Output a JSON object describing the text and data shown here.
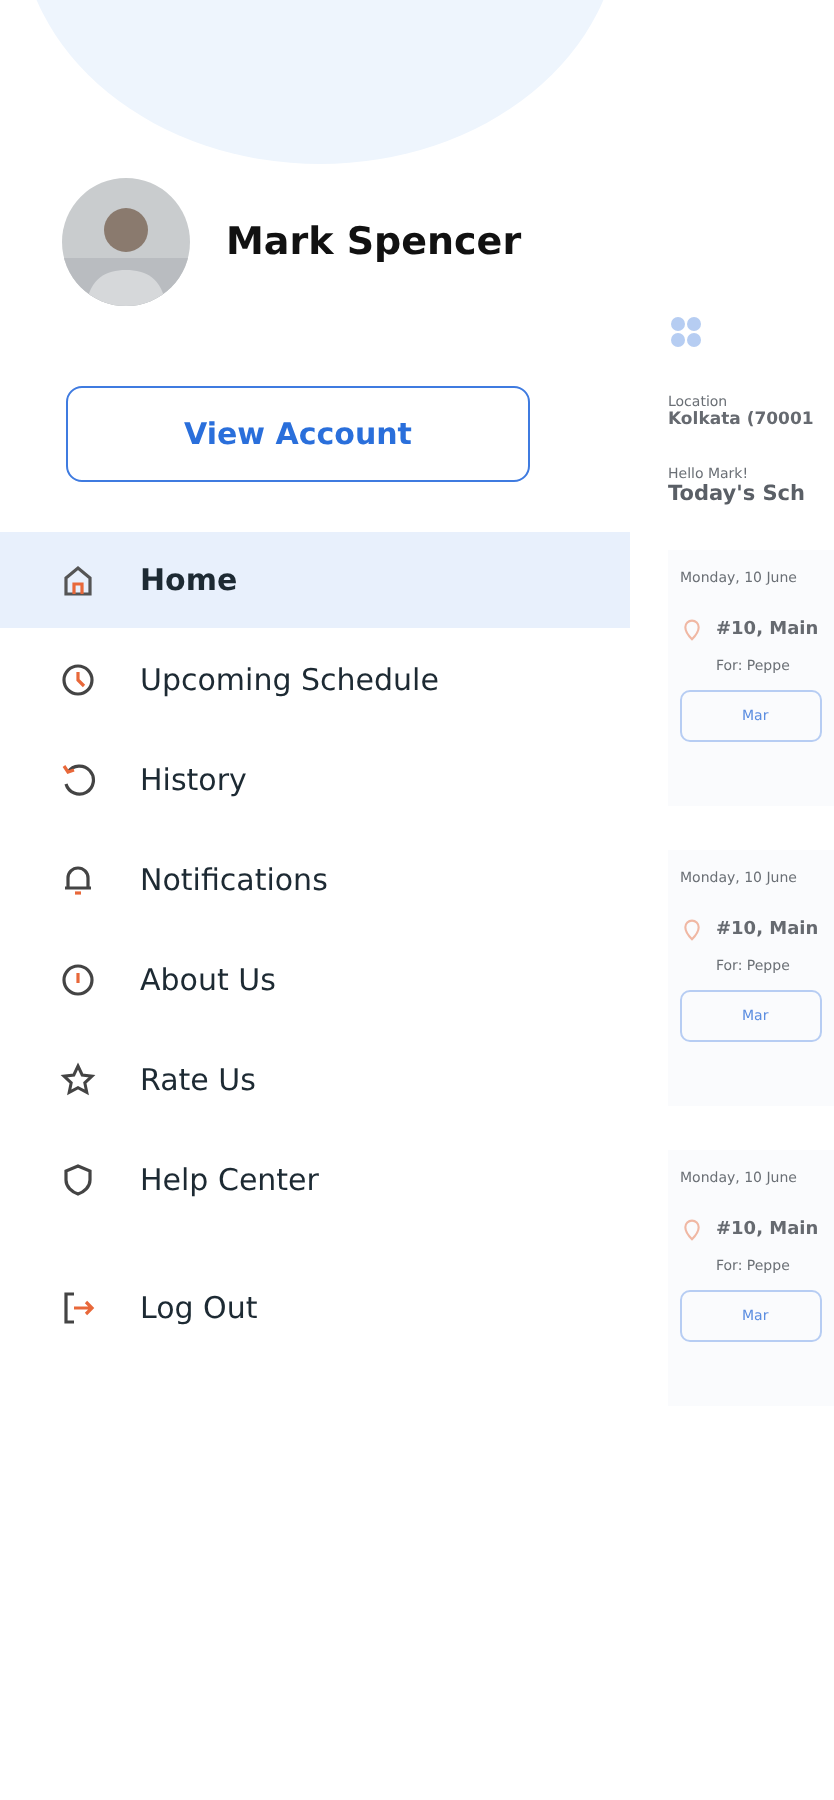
{
  "profile": {
    "name": "Mark Spencer",
    "button": "View Account"
  },
  "menu": [
    {
      "label": "Home",
      "selected": true
    },
    {
      "label": "Upcoming Schedule",
      "selected": false
    },
    {
      "label": "History",
      "selected": false
    },
    {
      "label": "Notifications",
      "selected": false
    },
    {
      "label": "About Us",
      "selected": false
    },
    {
      "label": "Rate Us",
      "selected": false
    },
    {
      "label": "Help Center",
      "selected": false
    }
  ],
  "logout": {
    "label": "Log Out"
  },
  "background_screen": {
    "location_label": "Location",
    "location": "Kolkata (70001",
    "greeting": "Hello Mark!",
    "heading": "Today's Sch",
    "cards": [
      {
        "date": "Monday, 10 June",
        "address": "#10, Main",
        "for": "For: Peppe",
        "button": "Mar"
      },
      {
        "date": "Monday, 10 June",
        "address": "#10, Main",
        "for": "For: Peppe",
        "button": "Mar"
      },
      {
        "date": "Monday, 10 June",
        "address": "#10, Main",
        "for": "For: Peppe",
        "button": "Mar"
      }
    ]
  }
}
